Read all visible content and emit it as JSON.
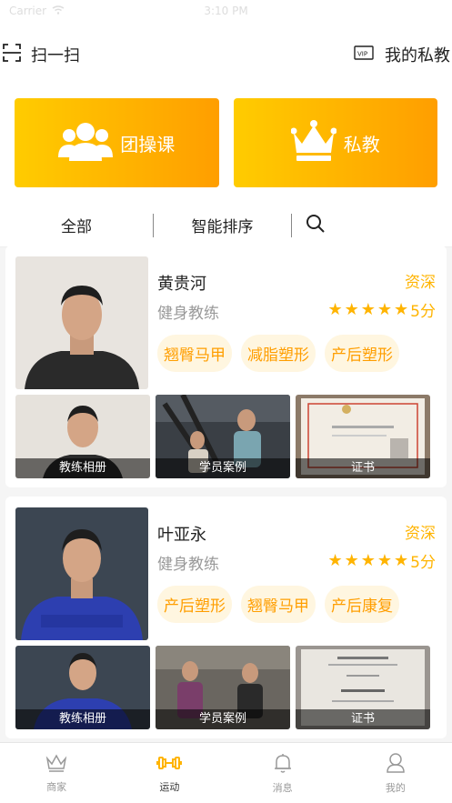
{
  "statusbar": {
    "carrier": "Carrier",
    "time": "3:10 PM"
  },
  "topbar": {
    "scan_label": "扫一扫",
    "private_label": "我的私教"
  },
  "hero": {
    "group_label": "团操课",
    "private_label": "私教"
  },
  "filters": {
    "all": "全部",
    "sort": "智能排序"
  },
  "coaches": [
    {
      "name": "黄贵河",
      "role": "健身教练",
      "level": "资深",
      "rating": "5分",
      "stars": 5,
      "tags": [
        "翘臀马甲",
        "减脂塑形",
        "产后塑形"
      ],
      "thumbs": [
        "教练相册",
        "学员案例",
        "证书"
      ]
    },
    {
      "name": "叶亚永",
      "role": "健身教练",
      "level": "资深",
      "rating": "5分",
      "stars": 5,
      "tags": [
        "产后塑形",
        "翘臀马甲",
        "产后康复"
      ],
      "thumbs": [
        "教练相册",
        "学员案例",
        "证书"
      ]
    }
  ],
  "tabbar": {
    "items": [
      {
        "label": "商家"
      },
      {
        "label": "运动"
      },
      {
        "label": "消息"
      },
      {
        "label": "我的"
      }
    ]
  },
  "colors": {
    "accent": "#ffb400",
    "gradient_start": "#ffcc00",
    "gradient_end": "#ff9e00"
  }
}
